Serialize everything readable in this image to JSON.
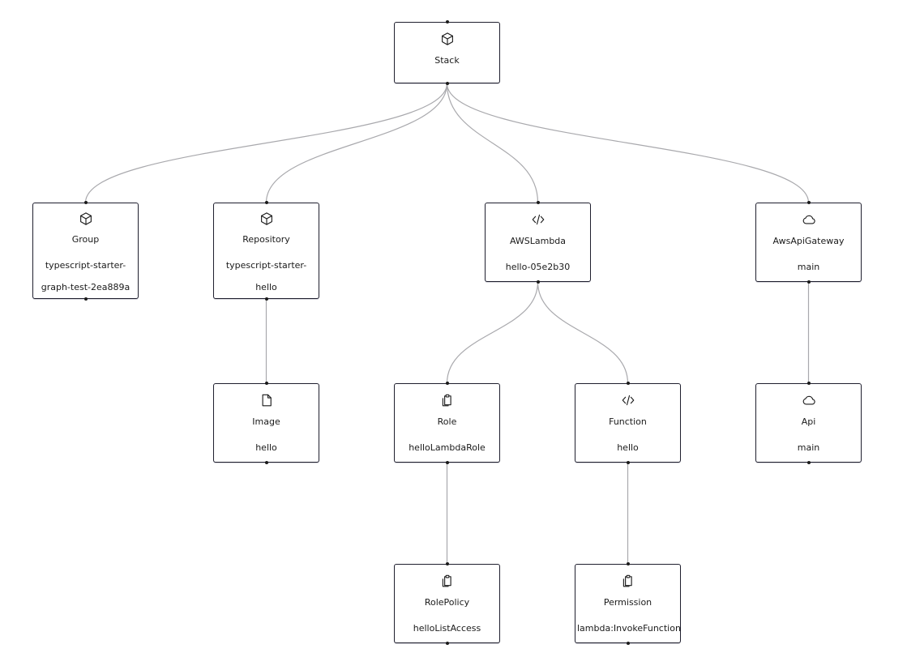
{
  "diagram": {
    "nodes": [
      {
        "id": "stack",
        "type": "Stack",
        "name": "",
        "icon": "cube-icon"
      },
      {
        "id": "group",
        "type": "Group",
        "name": "typescript-starter-graph-test-2ea889a",
        "name_lines": [
          "typescript-starter-",
          "graph-test-2ea889a"
        ],
        "icon": "cube-icon"
      },
      {
        "id": "repository",
        "type": "Repository",
        "name": "typescript-starter-hello",
        "name_lines": [
          "typescript-starter-",
          "hello"
        ],
        "icon": "cube-icon"
      },
      {
        "id": "awslambda",
        "type": "AWSLambda",
        "name": "hello-05e2b30",
        "icon": "code-icon"
      },
      {
        "id": "awsapigateway",
        "type": "AwsApiGateway",
        "name": "main",
        "icon": "cloud-icon"
      },
      {
        "id": "image",
        "type": "Image",
        "name": "hello",
        "icon": "file-icon"
      },
      {
        "id": "role",
        "type": "Role",
        "name": "helloLambdaRole",
        "icon": "clipboard-copy-icon"
      },
      {
        "id": "function",
        "type": "Function",
        "name": "hello",
        "icon": "code-icon"
      },
      {
        "id": "api",
        "type": "Api",
        "name": "main",
        "icon": "cloud-icon"
      },
      {
        "id": "rolepolicy",
        "type": "RolePolicy",
        "name": "helloListAccess",
        "icon": "clipboard-copy-icon"
      },
      {
        "id": "permission",
        "type": "Permission",
        "name": "lambda:InvokeFunction",
        "icon": "clipboard-copy-icon"
      }
    ],
    "edges": [
      {
        "from": "stack",
        "to": "group"
      },
      {
        "from": "stack",
        "to": "repository"
      },
      {
        "from": "stack",
        "to": "awslambda"
      },
      {
        "from": "stack",
        "to": "awsapigateway"
      },
      {
        "from": "repository",
        "to": "image"
      },
      {
        "from": "awslambda",
        "to": "role"
      },
      {
        "from": "awslambda",
        "to": "function"
      },
      {
        "from": "awsapigateway",
        "to": "api"
      },
      {
        "from": "role",
        "to": "rolepolicy"
      },
      {
        "from": "function",
        "to": "permission"
      }
    ],
    "colors": {
      "node_border": "#1f1f2e",
      "edge": "#a9a9ad",
      "text": "#1a1a1a"
    }
  }
}
